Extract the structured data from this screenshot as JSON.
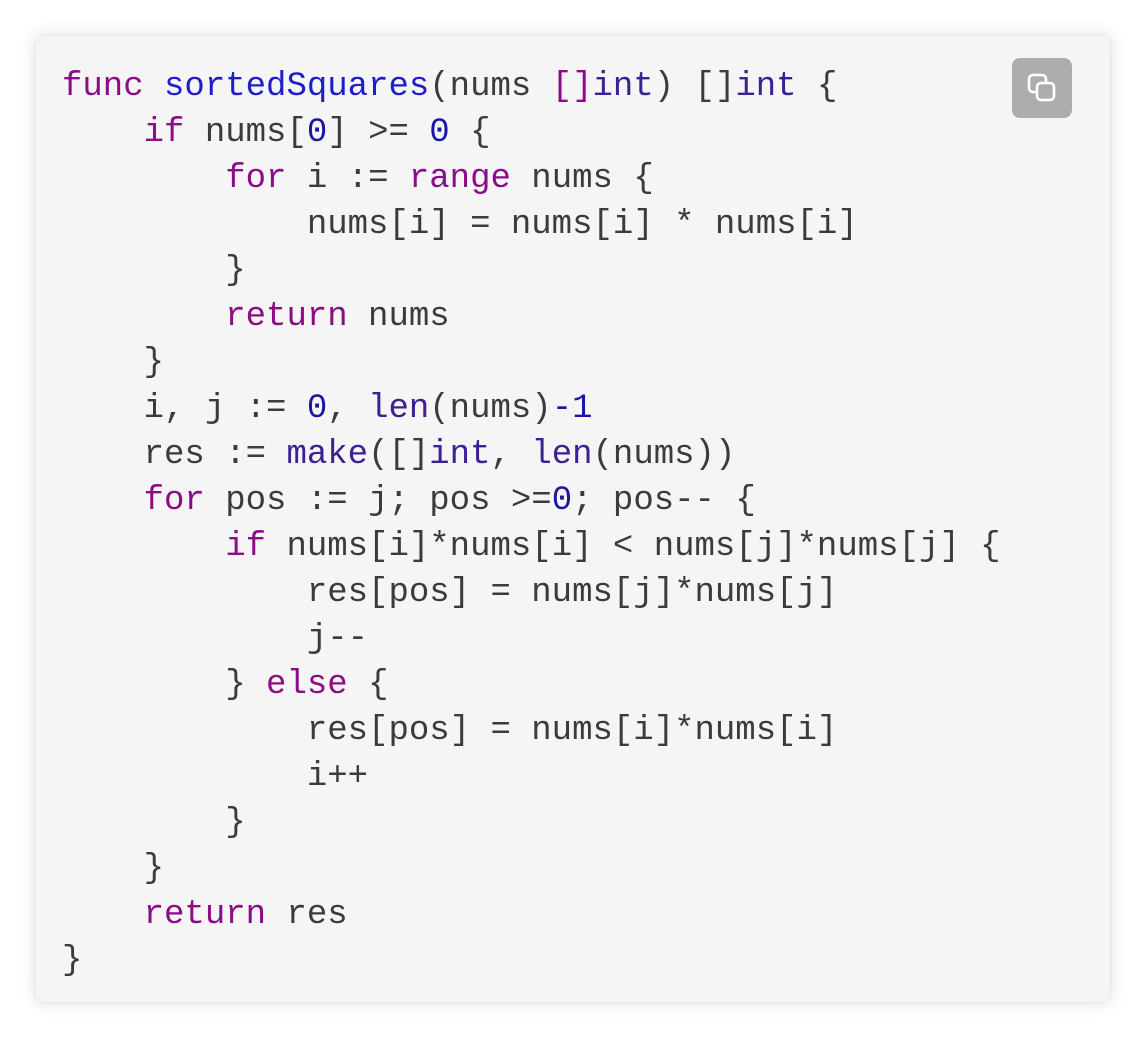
{
  "code_block": {
    "language": "Go",
    "copy_button": {
      "icon": "copy-icon"
    },
    "colors": {
      "keyword": "#8b0c87",
      "function_name": "#1c1dcb",
      "builtin": "#3d2190",
      "number": "#1b14a8",
      "plain": "#3b3b3b",
      "background": "#f5f5f5"
    },
    "lines": [
      [
        {
          "t": "kw",
          "v": "func"
        },
        {
          "t": "pl",
          "v": " "
        },
        {
          "t": "fn",
          "v": "sortedSquares"
        },
        {
          "t": "pl",
          "v": "(nums "
        },
        {
          "t": "kw",
          "v": "[]"
        },
        {
          "t": "bi",
          "v": "int"
        },
        {
          "t": "pl",
          "v": ") []"
        },
        {
          "t": "bi",
          "v": "int"
        },
        {
          "t": "pl",
          "v": " {"
        }
      ],
      [
        {
          "t": "pl",
          "v": "    "
        },
        {
          "t": "kw",
          "v": "if"
        },
        {
          "t": "pl",
          "v": " nums["
        },
        {
          "t": "num",
          "v": "0"
        },
        {
          "t": "pl",
          "v": "] >= "
        },
        {
          "t": "num",
          "v": "0"
        },
        {
          "t": "pl",
          "v": " {"
        }
      ],
      [
        {
          "t": "pl",
          "v": "        "
        },
        {
          "t": "kw",
          "v": "for"
        },
        {
          "t": "pl",
          "v": " i := "
        },
        {
          "t": "kw",
          "v": "range"
        },
        {
          "t": "pl",
          "v": " nums {"
        }
      ],
      [
        {
          "t": "pl",
          "v": "            nums[i] = nums[i] * nums[i]"
        }
      ],
      [
        {
          "t": "pl",
          "v": "        }"
        }
      ],
      [
        {
          "t": "pl",
          "v": "        "
        },
        {
          "t": "kw",
          "v": "return"
        },
        {
          "t": "pl",
          "v": " nums"
        }
      ],
      [
        {
          "t": "pl",
          "v": "    }"
        }
      ],
      [
        {
          "t": "pl",
          "v": "    i, j := "
        },
        {
          "t": "num",
          "v": "0"
        },
        {
          "t": "pl",
          "v": ", "
        },
        {
          "t": "bi",
          "v": "len"
        },
        {
          "t": "pl",
          "v": "(nums)"
        },
        {
          "t": "num",
          "v": "-1"
        }
      ],
      [
        {
          "t": "pl",
          "v": "    res := "
        },
        {
          "t": "bi",
          "v": "make"
        },
        {
          "t": "pl",
          "v": "([]"
        },
        {
          "t": "bi",
          "v": "int"
        },
        {
          "t": "pl",
          "v": ", "
        },
        {
          "t": "bi",
          "v": "len"
        },
        {
          "t": "pl",
          "v": "(nums))"
        }
      ],
      [
        {
          "t": "pl",
          "v": "    "
        },
        {
          "t": "kw",
          "v": "for"
        },
        {
          "t": "pl",
          "v": " pos := j; pos >="
        },
        {
          "t": "num",
          "v": "0"
        },
        {
          "t": "pl",
          "v": "; pos-- {"
        }
      ],
      [
        {
          "t": "pl",
          "v": "        "
        },
        {
          "t": "kw",
          "v": "if"
        },
        {
          "t": "pl",
          "v": " nums[i]*nums[i] < nums[j]*nums[j] {"
        }
      ],
      [
        {
          "t": "pl",
          "v": "            res[pos] = nums[j]*nums[j]"
        }
      ],
      [
        {
          "t": "pl",
          "v": "            j--"
        }
      ],
      [
        {
          "t": "pl",
          "v": "        } "
        },
        {
          "t": "kw",
          "v": "else"
        },
        {
          "t": "pl",
          "v": " {"
        }
      ],
      [
        {
          "t": "pl",
          "v": "            res[pos] = nums[i]*nums[i]"
        }
      ],
      [
        {
          "t": "pl",
          "v": "            i++"
        }
      ],
      [
        {
          "t": "pl",
          "v": "        }"
        }
      ],
      [
        {
          "t": "pl",
          "v": "    }"
        }
      ],
      [
        {
          "t": "pl",
          "v": "    "
        },
        {
          "t": "kw",
          "v": "return"
        },
        {
          "t": "pl",
          "v": " res"
        }
      ],
      [
        {
          "t": "pl",
          "v": "}"
        }
      ]
    ]
  }
}
